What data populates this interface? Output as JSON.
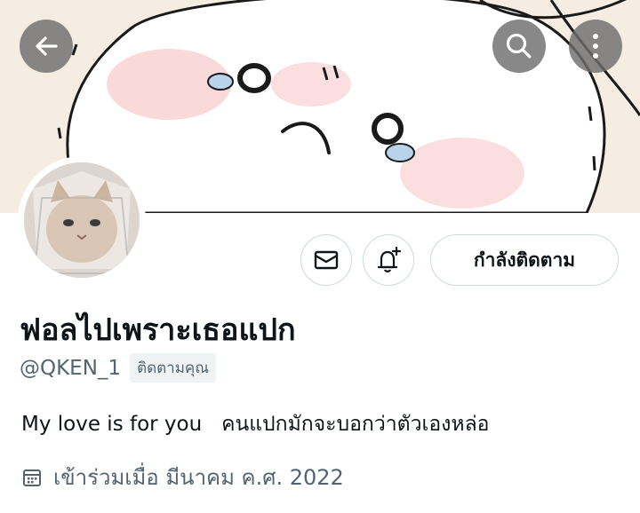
{
  "profile": {
    "display_name": "ฟอลไปเพราะเธอแปก",
    "handle": "@QKEN_1",
    "follows_you_badge": "ติดตามคุณ",
    "bio": "My love is for you   คนแปกมักจะบอกว่าตัวเองหล่อ",
    "joined": "เข้าร่วมเมื่อ มีนาคม ค.ศ. 2022"
  },
  "actions": {
    "following_label": "กำลังติดตาม"
  },
  "icons": {
    "back": "back-arrow-icon",
    "search": "search-icon",
    "more": "more-vertical-icon",
    "message": "envelope-icon",
    "notify": "bell-plus-icon",
    "calendar": "calendar-icon"
  },
  "colors": {
    "overlay_button": "#6e6e6e",
    "secondary_text": "#536471",
    "border": "#cfd9de",
    "badge_bg": "#eff3f4"
  }
}
